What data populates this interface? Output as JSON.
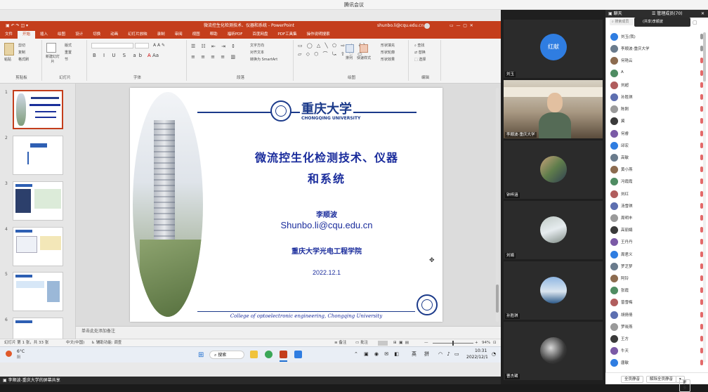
{
  "meeting": {
    "title": "腾讯会议",
    "share_label": "李顺波-重庆大学的屏幕共享"
  },
  "ppt": {
    "window_title": "微流控生化检测技术、仪器和系统 - PowerPoint",
    "account": "shunbo.li@cqu.edu.cn",
    "tabs": [
      "文件",
      "开始",
      "插入",
      "绘图",
      "设计",
      "切换",
      "动画",
      "幻灯片放映",
      "录制",
      "审阅",
      "视图",
      "帮助",
      "福昕PDF",
      "百度网盘",
      "PDF工具集",
      "操作说明搜索"
    ],
    "ribbon": {
      "clipboard": "剪贴板",
      "slides": "幻灯片",
      "font": "字体",
      "paragraph": "段落",
      "drawing": "绘图",
      "editing": "编辑",
      "paste": "粘贴",
      "cut": "剪切",
      "copy": "复制",
      "format": "格式刷",
      "new_slide": "新建幻灯片",
      "layout": "版式",
      "reset": "重置",
      "section": "节",
      "text_dir": "文字方向",
      "align_text": "对齐文本",
      "smartart": "转换为 SmartArt",
      "arrange": "排列",
      "quick_styles": "快速样式",
      "shape_fill": "形状填充",
      "shape_outline": "形状轮廓",
      "shape_effects": "形状效果",
      "find": "查找",
      "replace": "替换",
      "select": "选择"
    },
    "slide_numbers": [
      "1",
      "2",
      "3",
      "4",
      "5",
      "6"
    ],
    "notes_placeholder": "单击此处添加备注",
    "status": {
      "slide_info": "幻灯片 第 1 张，共 33 张",
      "language": "中文(中国)",
      "accessibility": "辅助功能: 调查",
      "notes": "备注",
      "comments": "批注",
      "zoom": "94%"
    }
  },
  "slide": {
    "university_cn": "重庆大学",
    "university_en": "CHONGQING  UNIVERSITY",
    "title_line1": "微流控生化检测技术、仪器",
    "title_line2": "和系统",
    "author": "李顺波",
    "email": "Shunbo.li@cqu.edu.cn",
    "college": "重庆大学光电工程学院",
    "date": "2022.12.1",
    "footer": "College of  optoelectronic engineering, Chongqing University"
  },
  "taskbar": {
    "weather": "6°C",
    "weather_desc": "阴",
    "search": "搜索",
    "ime1": "英",
    "ime2": "拼",
    "time": "10:31",
    "date": "2022/12/1"
  },
  "videos": [
    {
      "name": "刘玉",
      "avatar_text": "红献",
      "color": "#2f7de1"
    },
    {
      "name": "李顺波-重庆大学",
      "avatar_text": ""
    },
    {
      "name": "钟梓涵",
      "avatar_text": ""
    },
    {
      "name": "刘娟",
      "avatar_text": ""
    },
    {
      "name": "孙胜琪",
      "avatar_text": ""
    },
    {
      "name": "曹杰珺",
      "avatar_text": ""
    }
  ],
  "panel": {
    "tab_chat": "聊天",
    "tab_members": "管理成员(70)",
    "search": "搜索成员",
    "share_tab": "(共享)李顺波",
    "members": [
      "刘玉(我)",
      "李顺波-重庆大学",
      "何艳云",
      "A",
      "刘超",
      "孙胜琪",
      "陈刚",
      "冀",
      "何睿",
      "邱宏",
      "高敏",
      "黄小燕",
      "冯霞霞",
      "刘红",
      "汤雪琪",
      "周明丰",
      "高丽娟",
      "王丹丹",
      "周君义",
      "罗芝梦",
      "阿铃",
      "张霞",
      "曾雪梅",
      "胡倩倩",
      "罗晓燕",
      "王方",
      "牛天",
      "唐敏",
      "M"
    ],
    "footer_mute": "全员静音",
    "footer_unmute": "解除全员静音",
    "footer_more": "更多"
  }
}
